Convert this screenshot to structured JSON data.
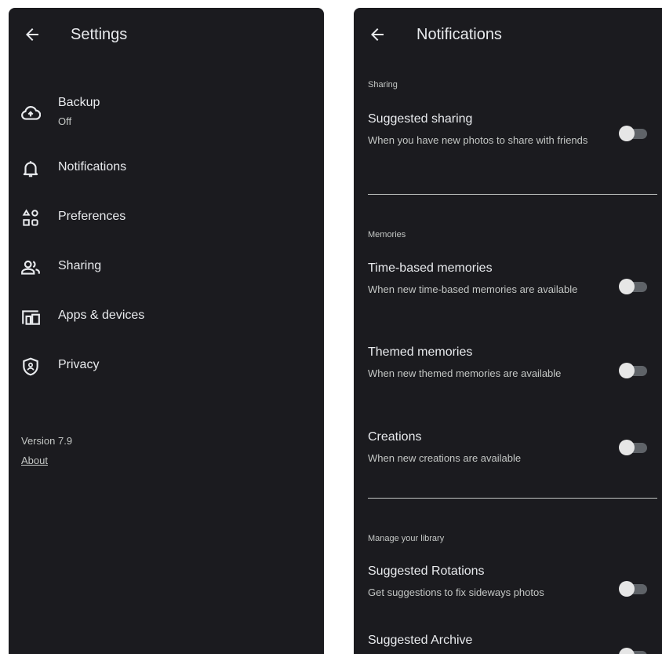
{
  "settings_screen": {
    "title": "Settings",
    "items": [
      {
        "label": "Backup",
        "sublabel": "Off",
        "icon": "cloud-upload-icon"
      },
      {
        "label": "Notifications",
        "icon": "bell-icon"
      },
      {
        "label": "Preferences",
        "icon": "preferences-icon"
      },
      {
        "label": "Sharing",
        "icon": "people-icon"
      },
      {
        "label": "Apps & devices",
        "icon": "devices-icon"
      },
      {
        "label": "Privacy",
        "icon": "shield-icon"
      }
    ],
    "version": "Version 7.9",
    "about": "About"
  },
  "notifications_screen": {
    "title": "Notifications",
    "sections": [
      {
        "header": "Sharing",
        "settings": [
          {
            "title": "Suggested sharing",
            "description": "When you have new photos to share with friends",
            "enabled": false
          }
        ]
      },
      {
        "header": "Memories",
        "settings": [
          {
            "title": "Time-based memories",
            "description": "When new time-based memories are available",
            "enabled": false
          },
          {
            "title": "Themed memories",
            "description": "When new themed memories are available",
            "enabled": false
          },
          {
            "title": "Creations",
            "description": "When new creations are available",
            "enabled": false
          }
        ]
      },
      {
        "header": "Manage your library",
        "settings": [
          {
            "title": "Suggested Rotations",
            "description": "Get suggestions to fix sideways photos",
            "enabled": false
          },
          {
            "title": "Suggested Archive",
            "description": "",
            "enabled": false
          }
        ]
      }
    ]
  },
  "colors": {
    "panel_background": "#1b1b1f",
    "text_primary": "#e8eaed",
    "text_secondary": "#c4c7c5",
    "toggle_track_off": "#5f6368",
    "toggle_thumb_off": "#e6e6e6"
  }
}
